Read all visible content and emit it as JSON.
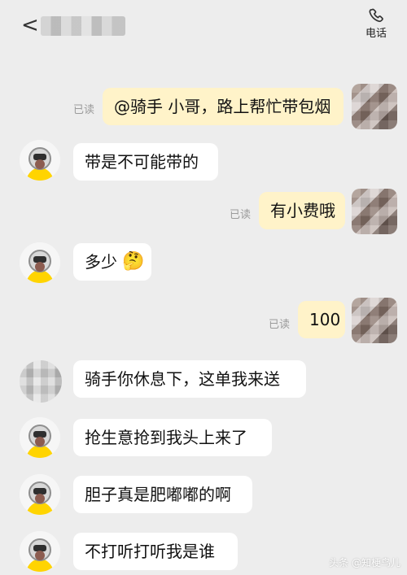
{
  "header": {
    "back_glyph": "<",
    "call_label": "电话"
  },
  "messages": [
    {
      "side": "right",
      "text": "@骑手 小哥，路上帮忙带包烟",
      "read": "已读"
    },
    {
      "side": "left",
      "text": "带是不可能带的"
    },
    {
      "side": "right",
      "text": "有小费哦",
      "read": "已读"
    },
    {
      "side": "left",
      "text": "多少",
      "emoji": "🤔"
    },
    {
      "side": "right",
      "text": "100",
      "read": "已读"
    },
    {
      "side": "left",
      "text": "骑手你休息下，这单我来送"
    },
    {
      "side": "left",
      "text": "抢生意抢到我头上来了"
    },
    {
      "side": "left",
      "text": "胆子真是肥嘟嘟的啊"
    },
    {
      "side": "left",
      "text": "不打听打听我是谁"
    }
  ],
  "watermark": "头条 @知梗鸟儿",
  "colors": {
    "background": "#ededed",
    "right_bubble": "#fff3c9",
    "left_bubble": "#ffffff",
    "read_text": "#9b9b9b",
    "avatar_yellow": "#ffd400"
  }
}
